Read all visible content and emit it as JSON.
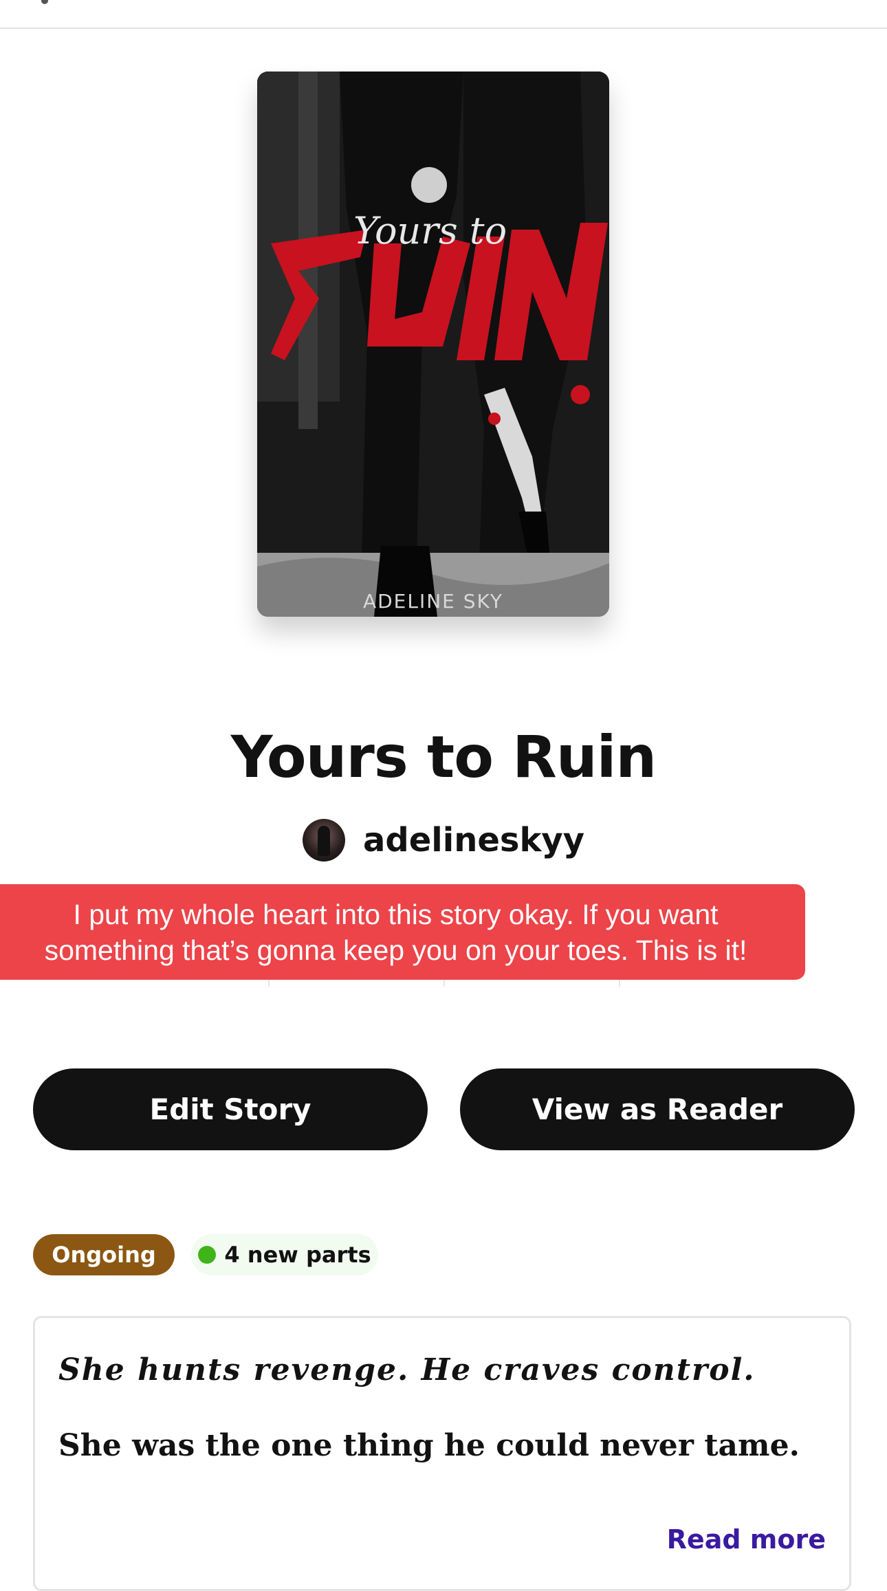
{
  "story": {
    "title": "Yours to Ruin",
    "author": "adelineskyy",
    "cover": {
      "script_title": "Yours to",
      "main_title": "RUIN",
      "author_text": "ADELINE SKY"
    }
  },
  "banner": {
    "line1": "I put my whole heart into this story okay. If you want",
    "line2": "something that’s gonna keep you on your toes. This is it!",
    "color": "#ec4449"
  },
  "actions": {
    "edit_label": "Edit Story",
    "view_label": "View as Reader"
  },
  "status": {
    "ongoing_label": "Ongoing",
    "new_parts_label": "4 new parts",
    "ongoing_color": "#8b5712",
    "new_dot_color": "#3fb41a"
  },
  "description": {
    "line1": "She hunts revenge. He craves control.",
    "line2": "She was the one thing he could never tame.",
    "read_more": "Read more",
    "link_color": "#3a1aa0"
  }
}
